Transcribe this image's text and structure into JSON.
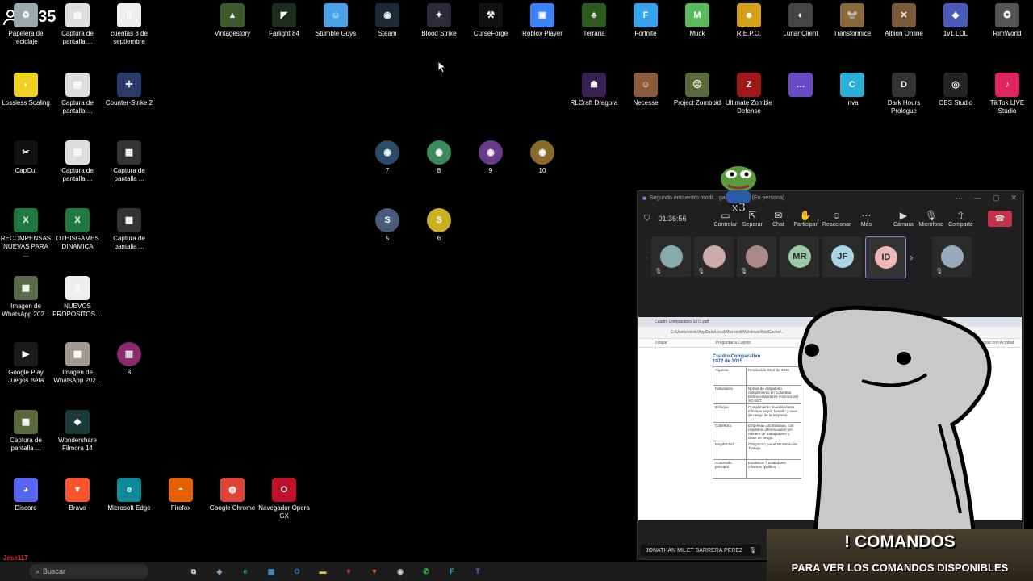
{
  "viewers": {
    "count": "135",
    "icon": "people-icon"
  },
  "desktop_icons": [
    {
      "label": "Papelera de reciclaje",
      "color": "#9aa",
      "glyph": "♻"
    },
    {
      "label": "Captura de pantalla ...",
      "color": "#ddd",
      "glyph": "▤"
    },
    {
      "label": "cuentas 3 de septiembre",
      "color": "#eee",
      "glyph": "▯"
    },
    {
      "label": "Vintagestory",
      "color": "#3f5a2a",
      "glyph": "▲"
    },
    {
      "label": "Farlight 84",
      "color": "#1e2e1e",
      "glyph": "◤"
    },
    {
      "label": "Stumble Guys",
      "color": "#4ca2e8",
      "glyph": "☺"
    },
    {
      "label": "Steam",
      "color": "#1b2838",
      "glyph": "◉"
    },
    {
      "label": "Blood Strike",
      "color": "#2a2a3a",
      "glyph": "✦"
    },
    {
      "label": "CurseForge",
      "color": "#111",
      "glyph": "⚒"
    },
    {
      "label": "Roblox Player",
      "color": "#3b82f6",
      "glyph": "▣"
    },
    {
      "label": "Terraria",
      "color": "#2e5a1e",
      "glyph": "♣"
    },
    {
      "label": "Fortnite",
      "color": "#36a3f0",
      "glyph": "F"
    },
    {
      "label": "Muck",
      "color": "#5cb85c",
      "glyph": "M"
    },
    {
      "label": "R.E.P.O.",
      "color": "#d4a017",
      "glyph": "☻"
    },
    {
      "label": "Lunar Client",
      "color": "#444",
      "glyph": "◐"
    },
    {
      "label": "Transformice",
      "color": "#8a6a3a",
      "glyph": "🐭"
    },
    {
      "label": "Albion Online",
      "color": "#7a5a3a",
      "glyph": "✕"
    },
    {
      "label": "1v1.LOL",
      "color": "#4a5ab8",
      "glyph": "◆"
    },
    {
      "label": "RimWorld",
      "color": "#555",
      "glyph": "✪"
    },
    {
      "label": "Lossless Scaling",
      "color": "#f0d020",
      "glyph": "◗"
    },
    {
      "label": "Captura de pantalla ...",
      "color": "#ddd",
      "glyph": "▤"
    },
    {
      "label": "Counter-Strike 2",
      "color": "#2a3a6a",
      "glyph": "✛"
    },
    {
      "label": "RLCraft Dregora",
      "color": "#3a2050",
      "glyph": "☗"
    },
    {
      "label": "Necesse",
      "color": "#8a5a3a",
      "glyph": "☺"
    },
    {
      "label": "Project Zomboid",
      "color": "#5a6a3a",
      "glyph": "☹"
    },
    {
      "label": "Ultimate Zombie Defense",
      "color": "#a01818",
      "glyph": "Z"
    },
    {
      "label": "",
      "color": "#6a4ac8",
      "glyph": "…"
    },
    {
      "label": "ınva",
      "color": "#2ab0d8",
      "glyph": "C"
    },
    {
      "label": "Dark Hours Prologue",
      "color": "#333",
      "glyph": "D"
    },
    {
      "label": "OBS Studio",
      "color": "#222",
      "glyph": "◎"
    },
    {
      "label": "TikTok LIVE Studio",
      "color": "#e0245e",
      "glyph": "♪"
    },
    {
      "label": "CapCut",
      "color": "#111",
      "glyph": "✂"
    },
    {
      "label": "Captura de pantalla ...",
      "color": "#ddd",
      "glyph": "▤"
    },
    {
      "label": "Captura de pantalla ...",
      "color": "#333",
      "glyph": "▦"
    },
    {
      "label": "7",
      "color": "#2a4a6a",
      "glyph": "◉"
    },
    {
      "label": "8",
      "color": "#3a8a5a",
      "glyph": "◉"
    },
    {
      "label": "9",
      "color": "#6a3a8a",
      "glyph": "◉"
    },
    {
      "label": "10",
      "color": "#8a6a2a",
      "glyph": "◉"
    },
    {
      "label": "RECOMPENSAS NUEVAS PARA ...",
      "color": "#1d7a3f",
      "glyph": "X"
    },
    {
      "label": "OTHISGAMES DINAMICA",
      "color": "#1d7a3f",
      "glyph": "X"
    },
    {
      "label": "Captura de pantalla ...",
      "color": "#333",
      "glyph": "▦"
    },
    {
      "label": "5",
      "color": "#4a5a7a",
      "glyph": "S"
    },
    {
      "label": "6",
      "color": "#c8b020",
      "glyph": "S"
    },
    {
      "label": "Imagen de WhatsApp 202...",
      "color": "#5a6a4a",
      "glyph": "▩"
    },
    {
      "label": "NUEVOS PROPOSITOS ...",
      "color": "#eee",
      "glyph": "▯"
    },
    {
      "label": "Google Play Juegos Beta",
      "color": "#1a1a1a",
      "glyph": "▶"
    },
    {
      "label": "Imagen de WhatsApp 202...",
      "color": "#a09a90",
      "glyph": "▩"
    },
    {
      "label": "8",
      "color": "#8a2a6a",
      "glyph": "▥"
    },
    {
      "label": "Captura de pantalla ...",
      "color": "#5a6a3a",
      "glyph": "▩"
    },
    {
      "label": "Wondershare Filmora 14",
      "color": "#1a3a3a",
      "glyph": "◆"
    },
    {
      "label": "Discord",
      "color": "#5865f2",
      "glyph": "◕"
    },
    {
      "label": "Brave",
      "color": "#fb542b",
      "glyph": "▼"
    },
    {
      "label": "Microsoft Edge",
      "color": "#0c8a9a",
      "glyph": "e"
    },
    {
      "label": "Firefox",
      "color": "#e66000",
      "glyph": "◓"
    },
    {
      "label": "Google Chrome",
      "color": "#db4437",
      "glyph": "◍"
    },
    {
      "label": "Navegador Opera GX",
      "color": "#c0102a",
      "glyph": "O"
    }
  ],
  "teams": {
    "title": "Segundo encuentro modi... gal enHSEQ (En persona)",
    "timer": "01:36:56",
    "toolbar": [
      "Controlar",
      "Separar",
      "Chat",
      "Participar",
      "Reaccionar",
      "Más",
      "Cámara",
      "Micrófono",
      "Comparte"
    ],
    "toolbar_icons": [
      "control-icon",
      "detach-icon",
      "chat-icon",
      "raise-hand-icon",
      "react-icon",
      "more-icon",
      "camera-icon",
      "mic-icon",
      "share-icon"
    ],
    "participants": [
      {
        "initials": "",
        "color": "#8aa"
      },
      {
        "initials": "",
        "color": "#caa"
      },
      {
        "initials": "",
        "color": "#a88"
      },
      {
        "initials": "MR",
        "color": "#9dc9a8"
      },
      {
        "initials": "JF",
        "color": "#a8d4e8"
      },
      {
        "initials": "ID",
        "color": "#f0b8b8"
      },
      {
        "initials": "",
        "color": "#9ab"
      }
    ],
    "presenter": "JONATHAN MILET BARRERA PEREZ",
    "share": {
      "tab": "Cuadro Comparativo 1072.pdf",
      "path": "C:/Users/onink/AppData/Local/Microsoft/Windows/INetCache/...",
      "menu": [
        "Dibujar",
        "Preguntar a Copilot",
        "Editar con Acrobat"
      ],
      "doc_title": "Cuadro Comparativo",
      "doc_subtitle": "1072 de 2015",
      "rows": [
        [
          "Aspecto",
          "Resolución 0312 de 2019"
        ],
        [
          "Naturaleza",
          "Norma de obligatorio cumplimiento en Colombia. Define estándares mínimos del SG-SST."
        ],
        [
          "Enfoque",
          "Cumplimiento de estándares mínimos según tamaño y nivel de riesgo de la empresa."
        ],
        [
          "Cobertura",
          "Empresas colombianas, con requisitos diferenciados por número de trabajadores y clase de riesgo."
        ],
        [
          "Exigibilidad",
          "Obligatorio por el Ministerio de Trabajo."
        ],
        [
          "Contenido principal",
          "Establece 7 estándares mínimos (política, ..."
        ]
      ]
    }
  },
  "overlay": {
    "title": "! COMANDOS",
    "subtitle": "PARA VER LOS COMANDOS DISPONIBLES"
  },
  "taskbar": {
    "search_placeholder": "Buscar",
    "chat_user": "Jese117",
    "apps": [
      {
        "name": "task-view-icon",
        "glyph": "⧉",
        "color": "#ccc"
      },
      {
        "name": "copilot-icon",
        "glyph": "◈",
        "color": "#8ac"
      },
      {
        "name": "edge-icon",
        "glyph": "e",
        "color": "#2a9"
      },
      {
        "name": "store-icon",
        "glyph": "▦",
        "color": "#48c"
      },
      {
        "name": "outlook-icon",
        "glyph": "O",
        "color": "#27c"
      },
      {
        "name": "explorer-icon",
        "glyph": "▬",
        "color": "#eb4"
      },
      {
        "name": "vpn-icon",
        "glyph": "▼",
        "color": "#c33"
      },
      {
        "name": "brave-icon",
        "glyph": "▼",
        "color": "#f53"
      },
      {
        "name": "steam-icon",
        "glyph": "◉",
        "color": "#ccc"
      },
      {
        "name": "whatsapp-icon",
        "glyph": "✆",
        "color": "#2c4"
      },
      {
        "name": "filmora-icon",
        "glyph": "F",
        "color": "#2ad"
      },
      {
        "name": "teams-icon",
        "glyph": "T",
        "color": "#66c"
      }
    ]
  }
}
